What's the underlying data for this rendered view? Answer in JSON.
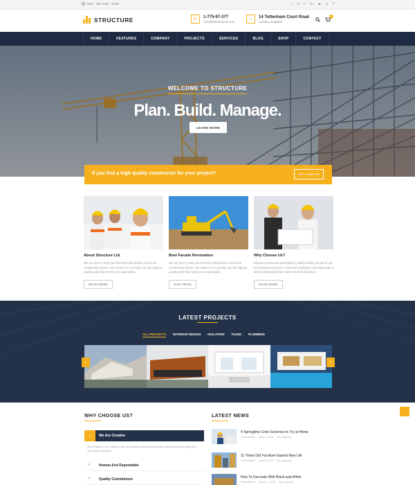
{
  "topbar": {
    "hours": "Mon - Sat: 9:00 - 18:00",
    "social": [
      "f",
      "in",
      "v",
      "G+",
      "▶",
      "⊙",
      "P"
    ]
  },
  "header": {
    "brand": "STRUCTURE",
    "phone": "1-775-97-377",
    "email": "info@themename.com",
    "address": "14 Tottenham Court Road",
    "city": "London, England",
    "cart_count": "0"
  },
  "nav": {
    "items": [
      "HOME",
      "FEATURES",
      "COMPANY",
      "PROJECTS",
      "SERVICES",
      "BLOG",
      "SHOP",
      "CONTACT"
    ]
  },
  "hero": {
    "kicker": "WELCOME TO STRUCTURE",
    "headline": "Plan. Build. Manage.",
    "button": "LEARN MORE"
  },
  "callout": {
    "text": "If you find a high quality constructor for your project?",
    "button": "GET A QUOTE"
  },
  "features": [
    {
      "title": "About Structure Ltd.",
      "text": "We are here to help you from the initial phase to the final construction phase. Our mission is to provide you the highest quality work that meets your expectation.",
      "button": "READ MORE"
    },
    {
      "title": "Best Facade Renovation",
      "text": "We are here to help you from the initial phase to the final construction phase. Our mission is to provide you the highest quality work that meets your expectation.",
      "button": "OUR PRICE"
    },
    {
      "title": "Why Choose Us?",
      "text": "Structure personnel participate in safety training at part of our best practices program, and each employee is provided with a skill set that helps them make the best decisions.",
      "button": "READ MORE"
    }
  ],
  "projects": {
    "title": "LATEST PROJECTS",
    "filters": [
      "ALL PROJECTS",
      "INTERIOR DESIGN",
      "ISOLATION",
      "TILING",
      "PLUMBING"
    ]
  },
  "why": {
    "title": "WHY CHOOSE US?",
    "active": "We Are Creative",
    "active_text": "As a leader in our industry, we have always worked to develop advanced technology and innovative methods.",
    "items": [
      "Honest And Dependable",
      "Quality Commitment"
    ]
  },
  "news": {
    "title": "LATEST NEWS",
    "items": [
      {
        "title": "4 Springtime Color Schemes to Try at Home",
        "author": "ThemeMove",
        "date": "April 6, 2015",
        "comments": "No response"
      },
      {
        "title": "11 Times Old Furniture Gained New Life",
        "author": "ThemeMove",
        "date": "April 6, 2015",
        "comments": "No response"
      },
      {
        "title": "How To Decorate With Black-and-White",
        "author": "ThemeMove",
        "date": "March 7, 2015",
        "comments": "No response"
      }
    ]
  },
  "colors": {
    "accent": "#f5b01c",
    "navy": "#1e2a41",
    "section": "#243249"
  }
}
